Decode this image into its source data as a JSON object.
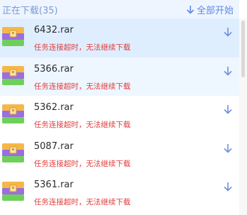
{
  "header": {
    "title": "正在下载(35)",
    "start_all_label": "全部开始",
    "start_all_icon": "arrow-down-icon"
  },
  "colors": {
    "accent": "#5a89e8",
    "error": "#e23b3b",
    "selected_row": "#dfeeff",
    "hover_row": "#eef6ff"
  },
  "downloads": [
    {
      "name": "6432.rar",
      "status": "任务连接超时，无法继续下载",
      "icon": "rar-archive-icon",
      "action_icon": "download-arrow-icon"
    },
    {
      "name": "5366.rar",
      "status": "任务连接超时，无法继续下载",
      "icon": "rar-archive-icon",
      "action_icon": "download-arrow-icon"
    },
    {
      "name": "5362.rar",
      "status": "任务连接超时，无法继续下载",
      "icon": "rar-archive-icon",
      "action_icon": "download-arrow-icon"
    },
    {
      "name": "5087.rar",
      "status": "任务连接超时，无法继续下载",
      "icon": "rar-archive-icon",
      "action_icon": "download-arrow-icon"
    },
    {
      "name": "5361.rar",
      "status": "任务连接超时，无法继续下载",
      "icon": "rar-archive-icon",
      "action_icon": "download-arrow-icon"
    }
  ]
}
